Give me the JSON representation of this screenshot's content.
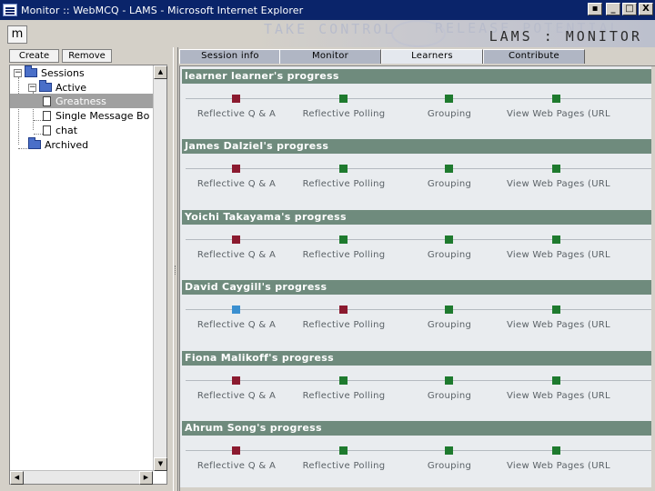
{
  "window": {
    "title": "Monitor :: WebMCQ - LAMS - Microsoft Internet Explorer",
    "controls": {
      "minimize": "_",
      "maximize": "□",
      "close": "X"
    }
  },
  "header": {
    "button_label": "m",
    "banner_ghost_left": "TAKE CONTROL",
    "banner_ghost_right": "RELEASE POTENTIAL",
    "banner_title": "LAMS : MONITOR"
  },
  "left_panel": {
    "create_label": "Create",
    "remove_label": "Remove",
    "tree": {
      "sessions": "Sessions",
      "active": "Active",
      "items": [
        "Greatness",
        "Single Message Bo",
        "chat"
      ],
      "archived": "Archived"
    }
  },
  "tabs": [
    "Session info",
    "Monitor",
    "Learners",
    "Contribute"
  ],
  "active_tab": "Learners",
  "activities": [
    "Reflective Q & A",
    "Reflective Polling",
    "Grouping",
    "View Web Pages (URL"
  ],
  "status_colors": {
    "not_started": "#8b1a2f",
    "completed": "#1e7a2e",
    "current": "#3a8fd0"
  },
  "learners": [
    {
      "name": "learner learner's progress",
      "statuses": [
        "not_started",
        "completed",
        "completed",
        "completed"
      ]
    },
    {
      "name": "James Dalziel's progress",
      "statuses": [
        "not_started",
        "completed",
        "completed",
        "completed"
      ]
    },
    {
      "name": "Yoichi Takayama's progress",
      "statuses": [
        "not_started",
        "completed",
        "completed",
        "completed"
      ]
    },
    {
      "name": "David Caygill's progress",
      "statuses": [
        "current",
        "not_started",
        "completed",
        "completed"
      ]
    },
    {
      "name": "Fiona Malikoff's progress",
      "statuses": [
        "not_started",
        "completed",
        "completed",
        "completed"
      ]
    },
    {
      "name": "Ahrum Song's progress",
      "statuses": [
        "not_started",
        "completed",
        "completed",
        "completed"
      ]
    }
  ]
}
